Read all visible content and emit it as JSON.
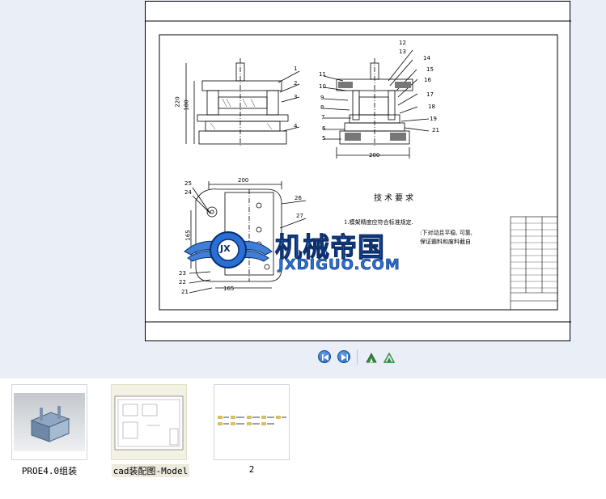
{
  "drawing": {
    "tech_title": "技术要求",
    "tech_lines": [
      "1.模架精度应符合标准规定.",
      ":下对动且平稳, 可靠,",
      "保证霸料和废料截自"
    ],
    "dims": {
      "d220": "220",
      "d180": "180",
      "d200a": "200",
      "d200b": "200",
      "d165a": "165",
      "d165b": "165"
    },
    "callouts_right": [
      "12",
      "13",
      "14",
      "15",
      "16",
      "17",
      "18",
      "19",
      "21"
    ],
    "callouts_left_mid": [
      "11",
      "10",
      "9",
      "8",
      "7",
      "6",
      "5"
    ],
    "callouts_top_left": [
      "1",
      "2",
      "3",
      "4"
    ],
    "callouts_bottom": [
      "25",
      "24",
      "26",
      "27",
      "23",
      "22",
      "21"
    ]
  },
  "watermark": {
    "cn": "机械帝国",
    "en": "JXDIGUO.COM",
    "badge": "JX"
  },
  "toolbar": {
    "first_page": "first-page-icon",
    "next_page": "next-page-icon",
    "zoom_in": "zoom-in-icon",
    "zoom_out": "zoom-out-icon"
  },
  "thumbnails": [
    {
      "label": "PROE4.0组装",
      "selected": false
    },
    {
      "label": "cad装配图-Model",
      "selected": true
    },
    {
      "label": "2",
      "selected": false
    }
  ],
  "colors": {
    "viewer_bg": "#e9eef7",
    "watermark_blue": "#2a6fd6",
    "nav_blue": "#1d5fb3",
    "zoom_green": "#2e8b3d"
  }
}
